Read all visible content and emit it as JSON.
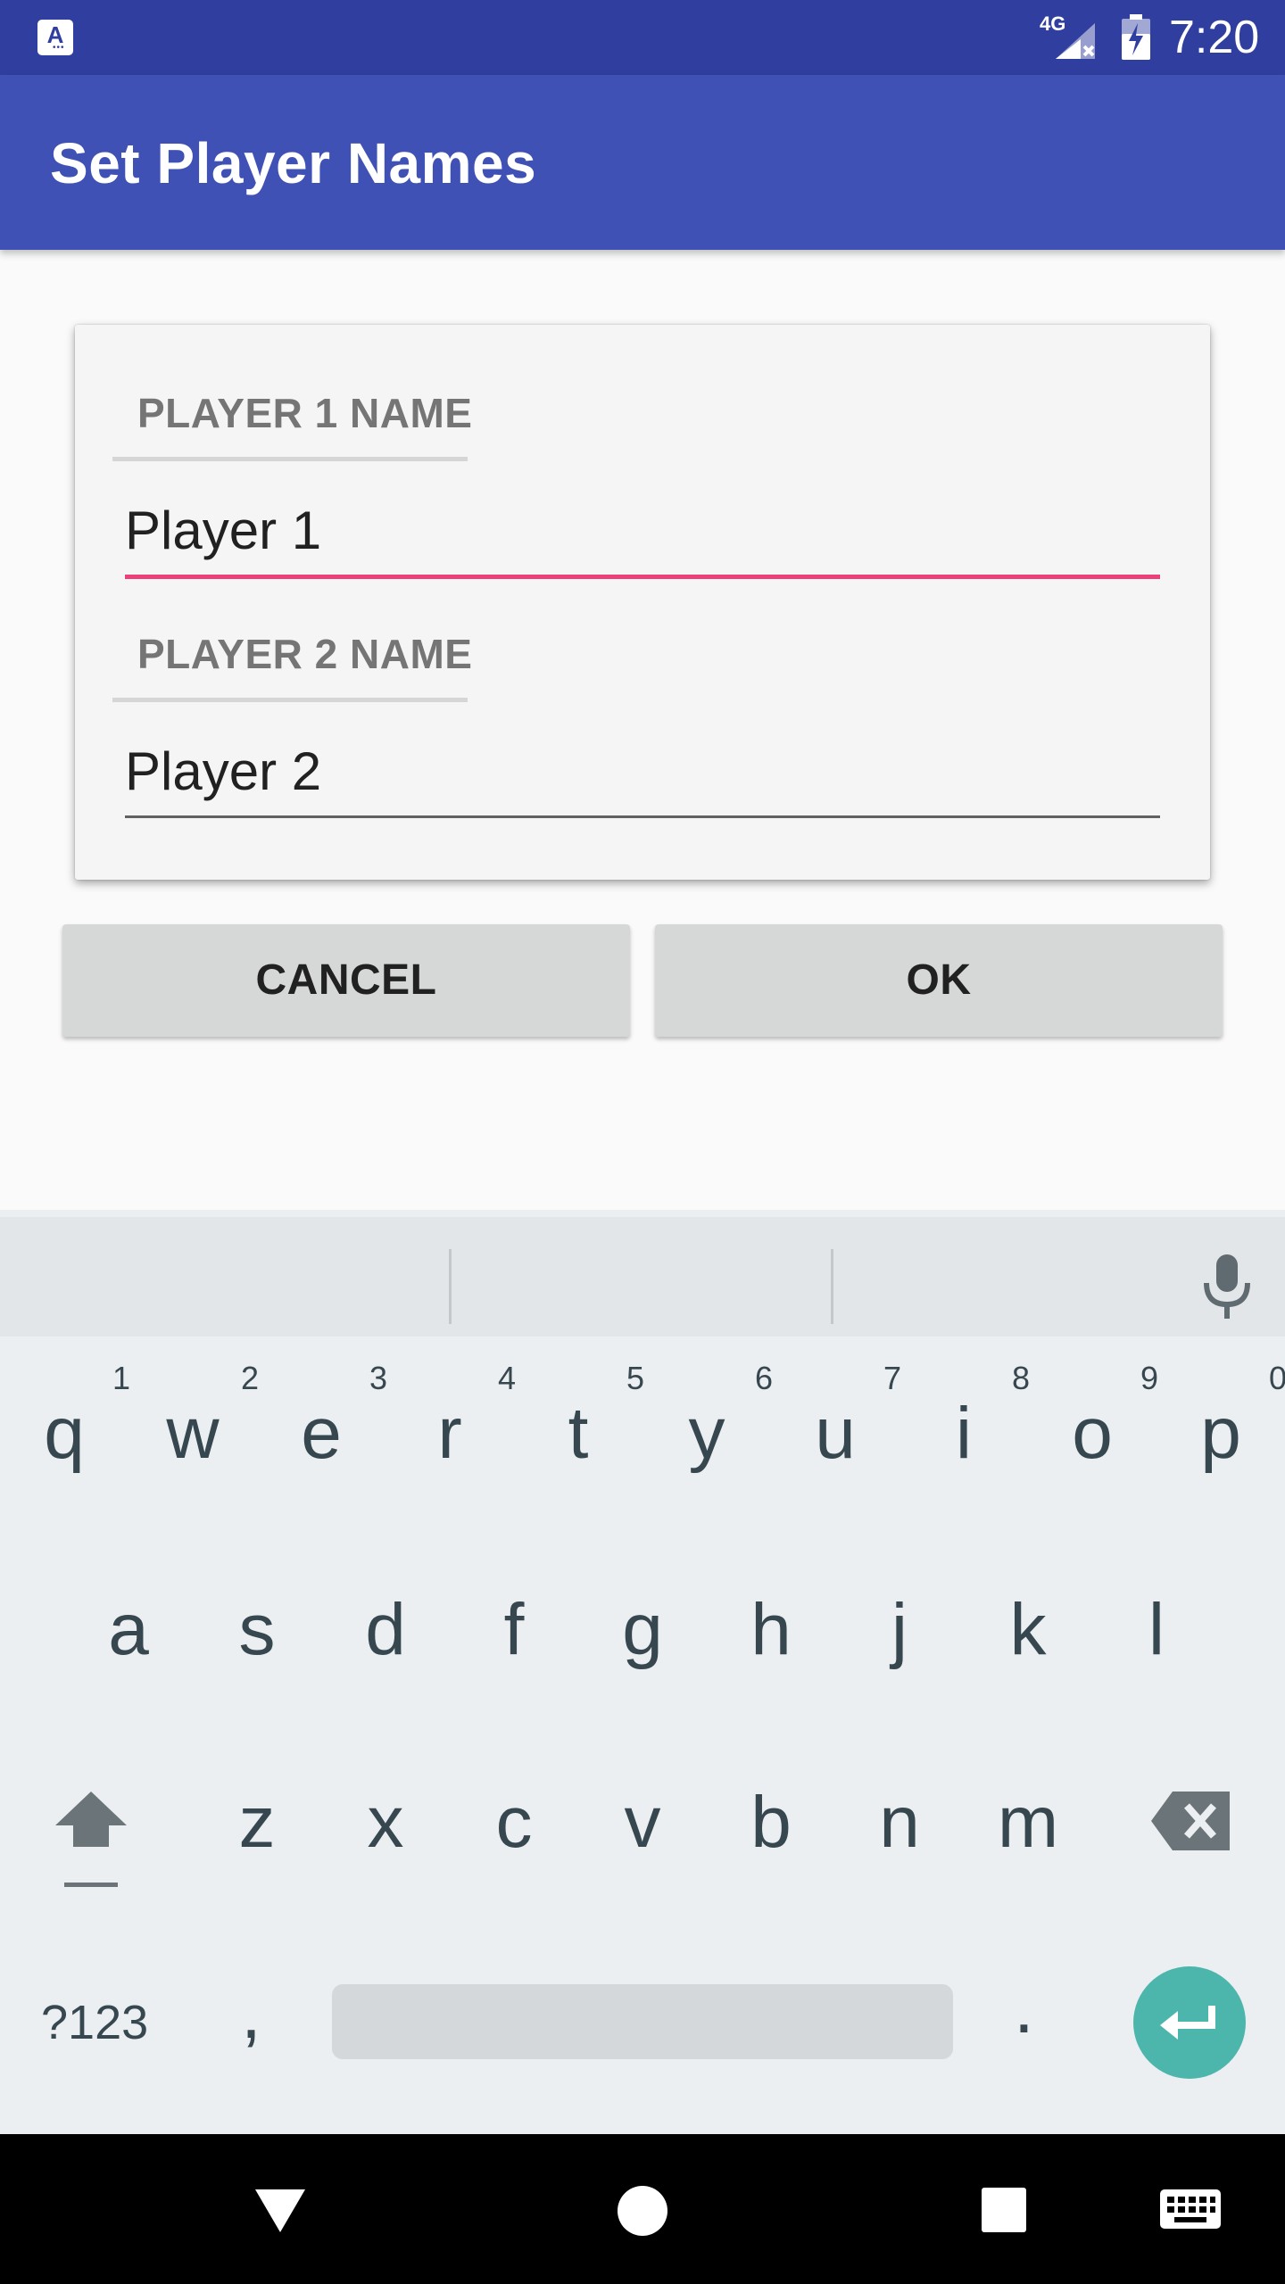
{
  "status_bar": {
    "app_icon": "keyboard-app-notification-icon",
    "app_icon_letter": "A",
    "network_type": "4G",
    "signal_icon": "signal-no-service-icon",
    "battery_icon": "battery-charging-icon",
    "time": "7:20"
  },
  "app_bar": {
    "title": "Set Player Names"
  },
  "form": {
    "player1": {
      "label": "PLAYER 1 NAME",
      "value": "Player 1",
      "focused": true
    },
    "player2": {
      "label": "PLAYER 2 NAME",
      "value": "Player 2",
      "focused": false
    }
  },
  "buttons": {
    "cancel": "CANCEL",
    "ok": "OK"
  },
  "keyboard": {
    "mic_icon": "microphone-icon",
    "row1": [
      {
        "key": "q",
        "hint": "1"
      },
      {
        "key": "w",
        "hint": "2"
      },
      {
        "key": "e",
        "hint": "3"
      },
      {
        "key": "r",
        "hint": "4"
      },
      {
        "key": "t",
        "hint": "5"
      },
      {
        "key": "y",
        "hint": "6"
      },
      {
        "key": "u",
        "hint": "7"
      },
      {
        "key": "i",
        "hint": "8"
      },
      {
        "key": "o",
        "hint": "9"
      },
      {
        "key": "p",
        "hint": "0"
      }
    ],
    "row2": [
      "a",
      "s",
      "d",
      "f",
      "g",
      "h",
      "j",
      "k",
      "l"
    ],
    "row3": [
      "z",
      "x",
      "c",
      "v",
      "b",
      "n",
      "m"
    ],
    "shift_icon": "shift-icon",
    "backspace_icon": "backspace-icon",
    "symbols": "?123",
    "comma": ",",
    "period": ".",
    "enter_icon": "enter-icon"
  },
  "nav_bar": {
    "back_icon": "back-triangle-icon",
    "home_icon": "home-circle-icon",
    "recents_icon": "recents-square-icon",
    "keyboard_switch_icon": "keyboard-switch-icon"
  },
  "colors": {
    "status_bar": "#303f9f",
    "app_bar": "#3f51b5",
    "accent": "#ec407a",
    "enter_key": "#4db6ac"
  }
}
